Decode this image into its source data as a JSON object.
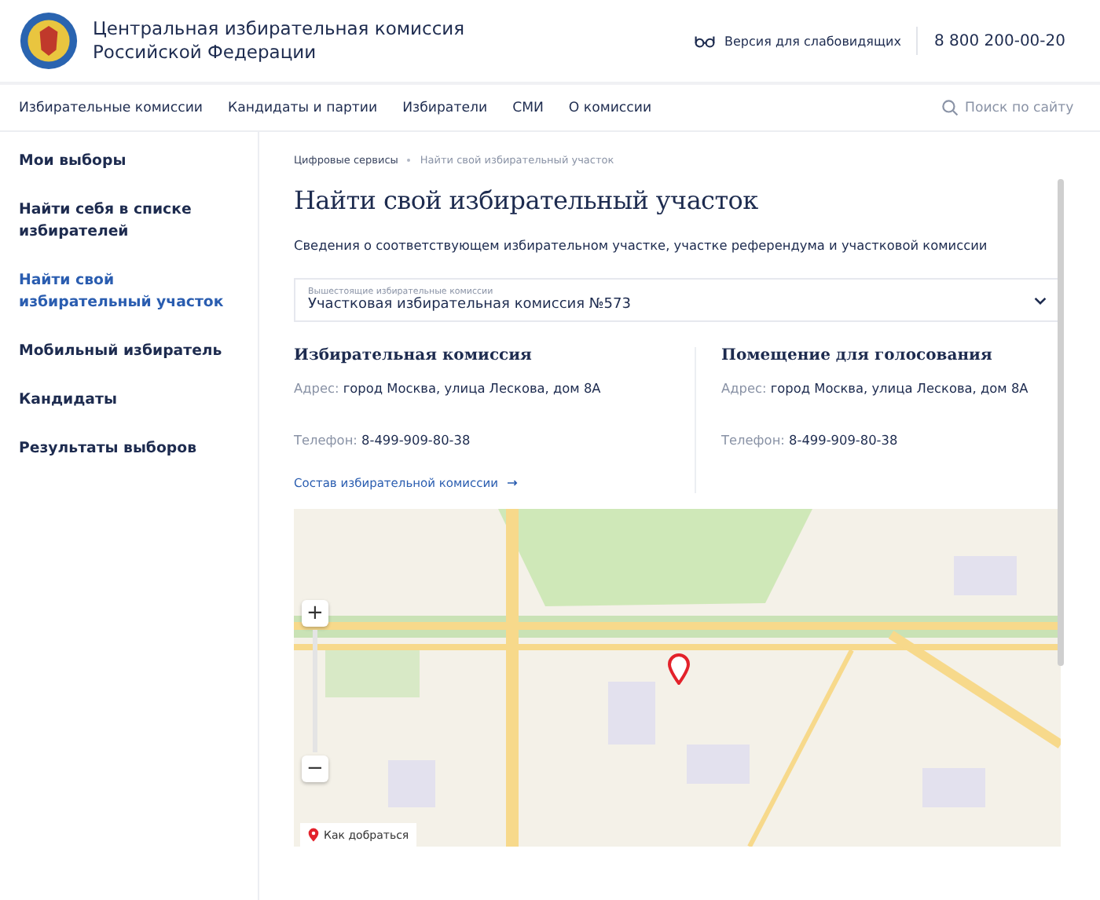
{
  "header": {
    "title": "Центральная избирательная комиссия Российской Федерации",
    "accessibility_link": "Версия для слабовидящих",
    "phone": "8 800 200-00-20"
  },
  "nav": {
    "items": [
      {
        "label": "Избирательные комиссии"
      },
      {
        "label": "Кандидаты и партии"
      },
      {
        "label": "Избиратели"
      },
      {
        "label": "СМИ"
      },
      {
        "label": "О комиссии"
      }
    ],
    "search": {
      "placeholder": "Поиск по сайту"
    }
  },
  "sidebar": {
    "items": [
      {
        "label": "Мои выборы",
        "selected": false
      },
      {
        "label": "Найти себя в списке избирателей",
        "selected": false
      },
      {
        "label": "Найти свой избирательный участок",
        "selected": true
      },
      {
        "label": "Мобильный избиратель",
        "selected": false
      },
      {
        "label": "Кандидаты",
        "selected": false
      },
      {
        "label": "Результаты выборов",
        "selected": false
      }
    ]
  },
  "breadcrumbs": [
    "Цифровые сервисы",
    "Найти свой избирательный участок"
  ],
  "page_title": "Найти свой избирательный участок",
  "description": "Сведения о соответствующем избирательном участке, участке референдума и участковой комиссии",
  "select": {
    "label": "Вышестоящие избирательные комиссии",
    "value": "Участковая избирательная комиссия №573"
  },
  "info_columns": [
    {
      "title": "Избирательная комиссия",
      "address_label": "Адрес:",
      "address": "город Москва, улица Лескова, дом 8А",
      "phone_label": "Телефон:",
      "phone": "8-499-909-80-38",
      "link": "Состав избирательной комиссии"
    },
    {
      "title": "Помещение для голосования",
      "address_label": "Адрес:",
      "address": "город Москва, улица Лескова, дом 8А",
      "phone_label": "Телефон:",
      "phone": "8-499-909-80-38"
    }
  ],
  "map": {
    "zoom_in": "+",
    "zoom_out": "−",
    "route_button": "Как добраться"
  }
}
